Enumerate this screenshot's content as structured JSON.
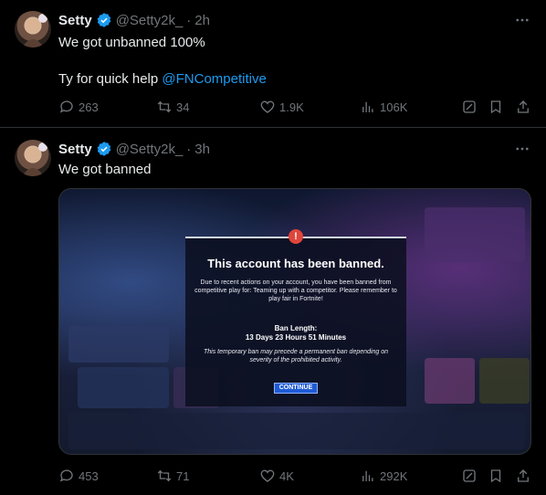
{
  "tweets": [
    {
      "author": {
        "name": "Setty",
        "handle": "@Setty2k_",
        "time": "2h"
      },
      "text_line1": "We got unbanned 100%",
      "text_line2_prefix": "Ty for quick help ",
      "mention": "@FNCompetitive",
      "stats": {
        "replies": "263",
        "retweets": "34",
        "likes": "1.9K",
        "views": "106K"
      }
    },
    {
      "author": {
        "name": "Setty",
        "handle": "@Setty2k_",
        "time": "3h"
      },
      "text_line1": "We got banned",
      "media": {
        "title": "This account has been banned.",
        "description": "Due to recent actions on your account, you have been banned from competitive play for: Teaming up with a competitor. Please remember to play fair in Fortnite!",
        "ban_length_label": "Ban Length:",
        "ban_length_value": "13 Days 23 Hours 51 Minutes",
        "note": "This temporary ban may precede a permanent ban depending on severity of the prohibited activity.",
        "button": "CONTINUE"
      },
      "stats": {
        "replies": "453",
        "retweets": "71",
        "likes": "4K",
        "views": "292K"
      }
    }
  ],
  "separator": "·",
  "colors": {
    "accent": "#1d9bf0",
    "muted": "#71767b",
    "text": "#e7e9ea"
  },
  "icons": [
    "verified-badge-icon",
    "more-icon",
    "reply-icon",
    "retweet-icon",
    "like-icon",
    "views-icon",
    "grok-icon",
    "bookmark-icon",
    "share-icon",
    "warning-icon"
  ]
}
